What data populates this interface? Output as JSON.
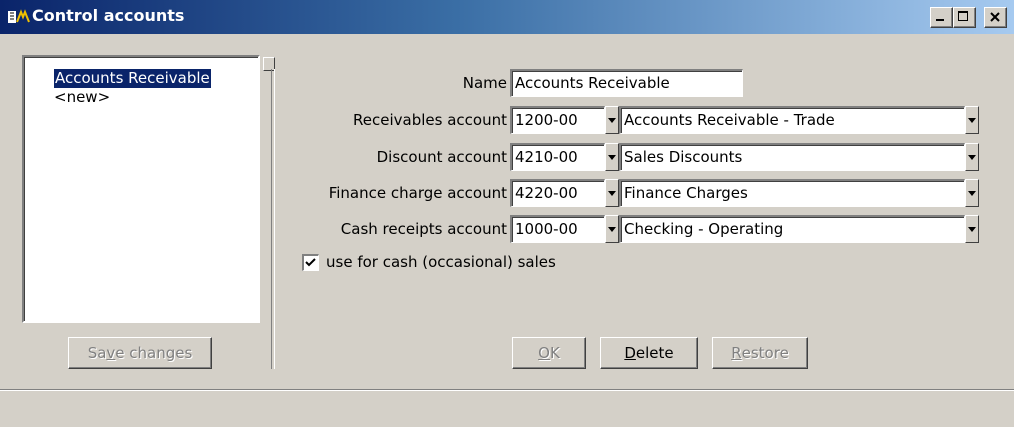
{
  "window": {
    "title": "Control accounts",
    "controls": [
      "minimize-icon",
      "maximize-icon",
      "close-icon"
    ]
  },
  "list": {
    "items": [
      {
        "label": "Accounts Receivable",
        "selected": true
      },
      {
        "label": "<new>",
        "selected": false
      }
    ]
  },
  "buttons": {
    "save_changes": {
      "pre": "Sa",
      "accel": "v",
      "post": "e changes",
      "enabled": false
    },
    "ok": {
      "pre": "",
      "accel": "O",
      "post": "K",
      "enabled": false
    },
    "delete": {
      "pre": "",
      "accel": "D",
      "post": "elete",
      "enabled": true
    },
    "restore": {
      "pre": "",
      "accel": "R",
      "post": "estore",
      "enabled": false
    }
  },
  "form": {
    "name_label": "Name",
    "name_value": "Accounts Receivable",
    "accounts": [
      {
        "label": "Receivables account",
        "code": "1200-00",
        "description": "Accounts Receivable - Trade"
      },
      {
        "label": "Discount account",
        "code": "4210-00",
        "description": "Sales Discounts"
      },
      {
        "label": "Finance charge account",
        "code": "4220-00",
        "description": "Finance Charges"
      },
      {
        "label": "Cash receipts account",
        "code": "1000-00",
        "description": "Checking - Operating"
      }
    ],
    "cash_sales_checkbox": {
      "label": "use for cash (occasional) sales",
      "checked": true
    }
  },
  "colors": {
    "titlebar_start": "#0a246a",
    "titlebar_end": "#a6caf0",
    "face": "#d4d0c8",
    "selection": "#0a246a"
  }
}
